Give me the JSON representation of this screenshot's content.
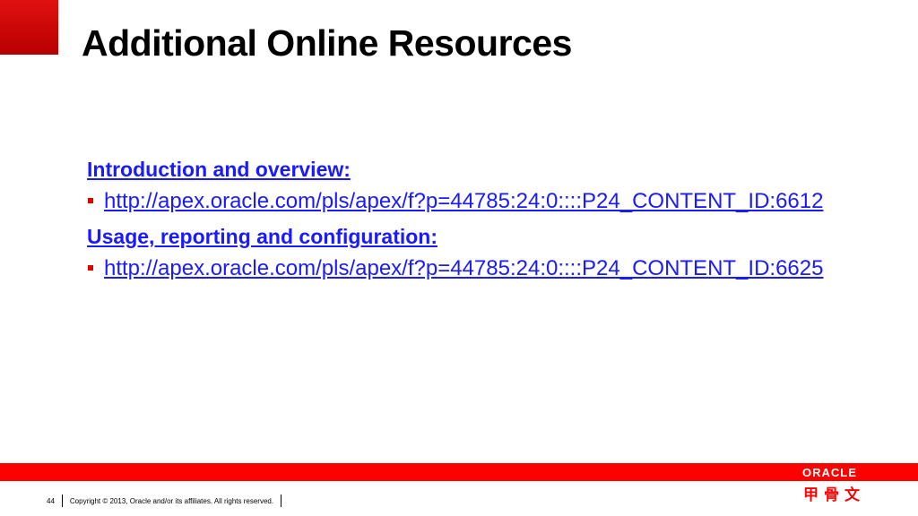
{
  "slide": {
    "title": "Additional Online Resources"
  },
  "sections": [
    {
      "heading": "Introduction and overview:",
      "link": "http://apex.oracle.com/pls/apex/f?p=44785:24:0::::P24_CONTENT_ID:6612"
    },
    {
      "heading": "Usage, reporting and configuration:",
      "link": "http://apex.oracle.com/pls/apex/f?p=44785:24:0::::P24_CONTENT_ID:6625"
    }
  ],
  "footer": {
    "page_number": "44",
    "copyright": "Copyright © 2013, Oracle and/or its affiliates. All rights reserved.",
    "brand_logo": "ORACLE",
    "brand_logo_cn": "甲骨文"
  },
  "colors": {
    "accent_red": "#ff0000",
    "link_blue": "#1a1aff"
  }
}
